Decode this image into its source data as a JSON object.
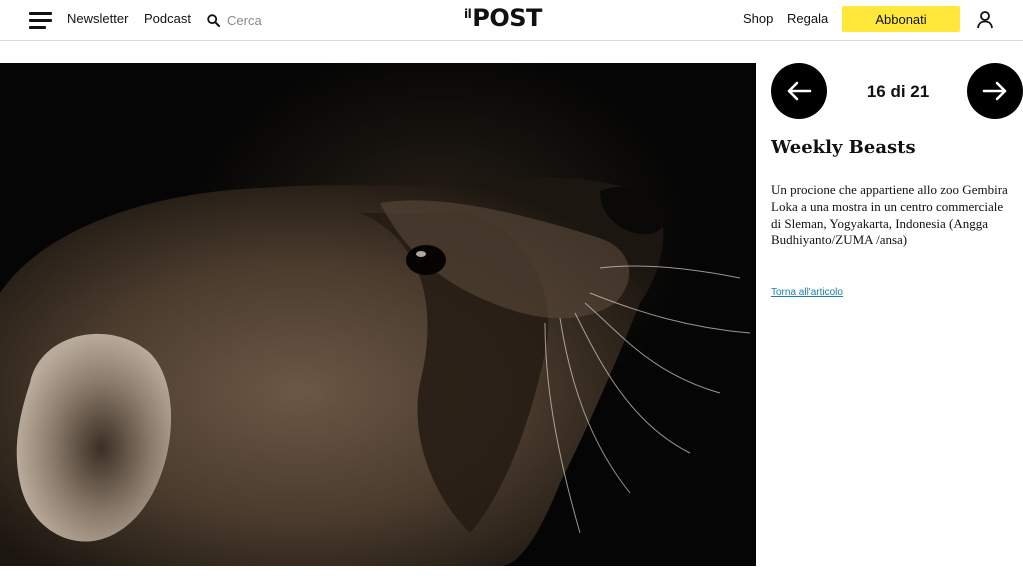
{
  "header": {
    "nav": {
      "newsletter": "Newsletter",
      "podcast": "Podcast"
    },
    "search": {
      "placeholder": "Cerca"
    },
    "logo": {
      "il": "il",
      "post": "POST"
    },
    "shop": "Shop",
    "regala": "Regala",
    "subscribe": "Abbonati",
    "icons": [
      "menu-icon",
      "search-icon",
      "user-icon"
    ]
  },
  "gallery": {
    "counter": "16 di 21",
    "title": "Weekly Beasts",
    "caption": "Un procione che appartiene allo zoo Gembira Loka a una mostra in un centro commerciale di Sleman, Yogyakarta, Indonesia (Angga Budhiyanto/ZUMA /ansa)",
    "back_link": "Torna all'articolo",
    "icons": [
      "arrow-left-icon",
      "arrow-right-icon"
    ]
  },
  "colors": {
    "accent_yellow": "#ffe83a",
    "nav_button": "#000000",
    "link": "#1a7fb0"
  }
}
